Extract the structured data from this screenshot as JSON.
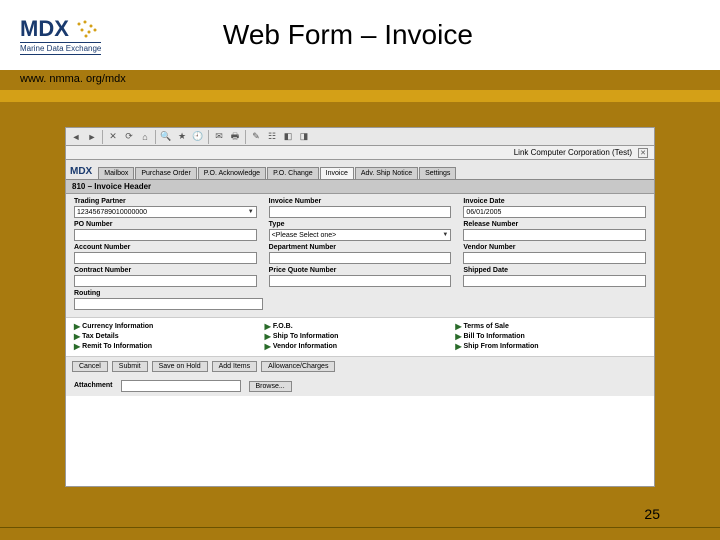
{
  "slide": {
    "title": "Web Form – Invoice",
    "url": "www. nmma. org/mdx",
    "page_number": "25"
  },
  "logo": {
    "main": "MDX",
    "sub": "Marine Data Exchange"
  },
  "app": {
    "company": "Link Computer Corporation (Test)",
    "logo_main": "MDX",
    "logo_sub": "Marine Data Exchange",
    "tabs": [
      "Mailbox",
      "Purchase Order",
      "P.O. Acknowledge",
      "P.O. Change",
      "Invoice",
      "Adv. Ship Notice",
      "Settings"
    ],
    "active_tab": "Invoice",
    "section_header": "810 – Invoice Header",
    "fields": {
      "trading_partner_label": "Trading Partner",
      "trading_partner_value": "123456789010000000",
      "invoice_number_label": "Invoice Number",
      "invoice_number_value": "",
      "invoice_date_label": "Invoice Date",
      "invoice_date_value": "06/01/2005",
      "po_number_label": "PO Number",
      "po_number_value": "",
      "type_label": "Type",
      "type_value": "<Please Select one>",
      "release_number_label": "Release Number",
      "release_number_value": "",
      "account_number_label": "Account Number",
      "account_number_value": "",
      "department_number_label": "Department Number",
      "department_number_value": "",
      "vendor_number_label": "Vendor Number",
      "vendor_number_value": "",
      "contract_number_label": "Contract Number",
      "contract_number_value": "",
      "price_quote_number_label": "Price Quote Number",
      "price_quote_number_value": "",
      "shipped_date_label": "Shipped Date",
      "shipped_date_value": "",
      "routing_label": "Routing",
      "routing_value": ""
    },
    "links_col1": [
      "Currency Information",
      "Tax Details",
      "Remit To Information"
    ],
    "links_col2": [
      "F.O.B.",
      "Ship To Information",
      "Vendor Information"
    ],
    "links_col3": [
      "Terms of Sale",
      "Bill To Information",
      "Ship From Information"
    ],
    "buttons": {
      "cancel": "Cancel",
      "submit": "Submit",
      "save_on_hold": "Save on Hold",
      "add_items": "Add Items",
      "allowance_charges": "Allowance/Charges"
    },
    "attachment_label": "Attachment",
    "attachment_value": "",
    "browse": "Browse..."
  }
}
